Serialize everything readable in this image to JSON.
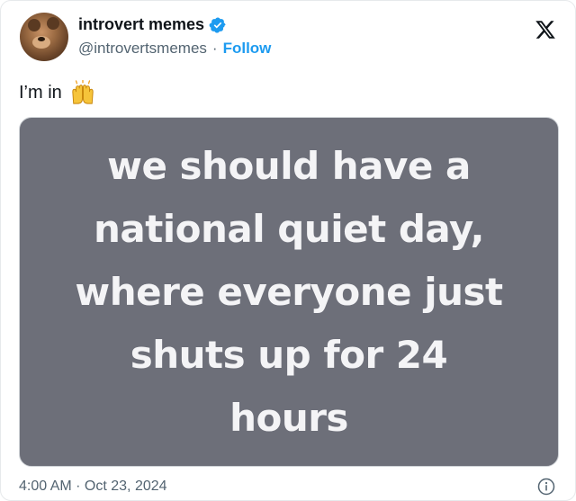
{
  "author": {
    "display_name": "introvert memes",
    "handle": "@introvertsmemes",
    "separator": "·",
    "follow_label": "Follow"
  },
  "tweet": {
    "text": "I’m in",
    "emoji": "raised-hands-icon",
    "image_text": "we should have a\nnational quiet day,\nwhere everyone just\nshuts up for 24\nhours",
    "timestamp": "4:00 AM · Oct 23, 2024"
  },
  "colors": {
    "accent": "#1d9bf0",
    "secondary_text": "#536471",
    "media_bg": "#6d6f79"
  },
  "icons": {
    "verified": "verified-badge-icon",
    "platform": "x-logo-icon",
    "info": "info-icon"
  }
}
